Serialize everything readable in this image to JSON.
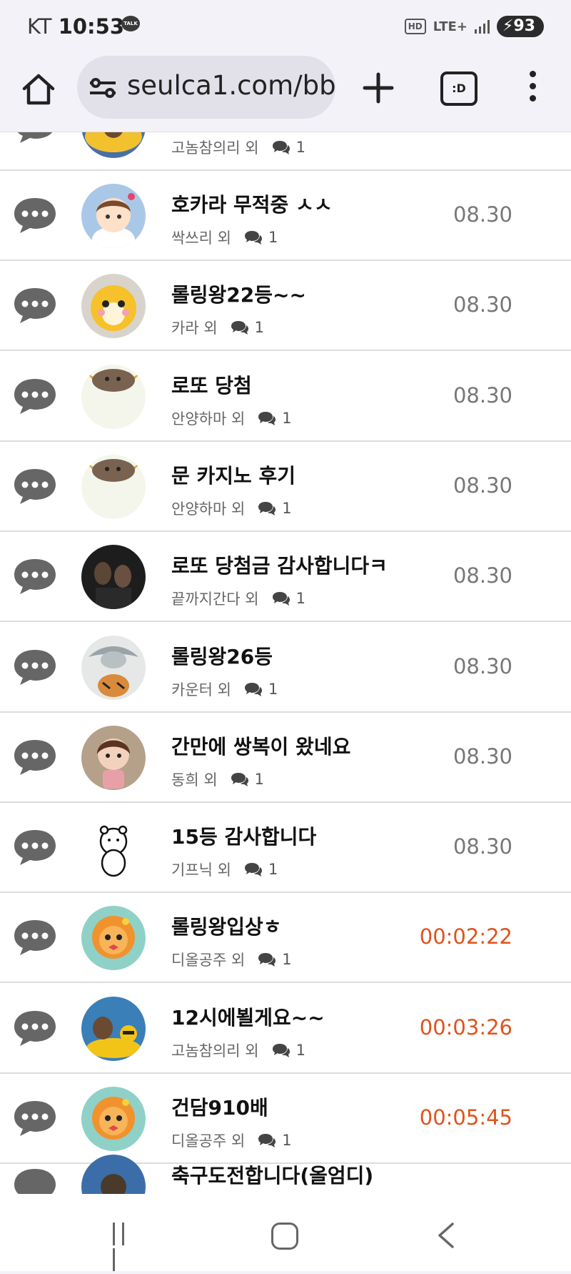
{
  "status_bar": {
    "carrier": "KT",
    "time": "10:53",
    "talk_badge": "TALK",
    "hd_label": "HD",
    "network": "LTE+",
    "battery": "93"
  },
  "browser": {
    "url": "seulca1.com/bb",
    "tabs_label": ":D"
  },
  "list": {
    "partial_top": {
      "author": "고놈참의리 외",
      "comments": "1"
    },
    "rows": [
      {
        "title": "호카라 무적중 ㅅㅅ",
        "author": "싹쓰리 외",
        "comments": "1",
        "date": "08.30",
        "recent": false,
        "avatar": "girl"
      },
      {
        "title": "롤링왕22등~~",
        "author": "카라 외",
        "comments": "1",
        "date": "08.30",
        "recent": false,
        "avatar": "tiger-cub"
      },
      {
        "title": "로또 당첨",
        "author": "안양하마 외",
        "comments": "1",
        "date": "08.30",
        "recent": false,
        "avatar": "bowl-cat"
      },
      {
        "title": "문 카지노 후기",
        "author": "안양하마 외",
        "comments": "1",
        "date": "08.30",
        "recent": false,
        "avatar": "bowl-cat"
      },
      {
        "title": "로또 당첨금 감사합니다ㅋ",
        "author": "끝까지간다 외",
        "comments": "1",
        "date": "08.30",
        "recent": false,
        "avatar": "dark-photo"
      },
      {
        "title": "롤링왕26등",
        "author": "카운터 외",
        "comments": "1",
        "date": "08.30",
        "recent": false,
        "avatar": "dragon-tiger"
      },
      {
        "title": "간만에 쌍복이 왔네요",
        "author": "동희 외",
        "comments": "1",
        "date": "08.30",
        "recent": false,
        "avatar": "doll"
      },
      {
        "title": "15등 감사합니다",
        "author": "기프닉 외",
        "comments": "1",
        "date": "08.30",
        "recent": false,
        "avatar": "sketch-bear"
      },
      {
        "title": "롤링왕입상ㅎ",
        "author": "디올공주 외",
        "comments": "1",
        "date": "00:02:22",
        "recent": true,
        "avatar": "lion"
      },
      {
        "title": "12시에뵐게요~~",
        "author": "고놈참의리 외",
        "comments": "1",
        "date": "00:03:26",
        "recent": true,
        "avatar": "otter-duck"
      },
      {
        "title": "건담910배",
        "author": "디올공주 외",
        "comments": "1",
        "date": "00:05:45",
        "recent": true,
        "avatar": "lion"
      }
    ],
    "partial_bottom_title": "축구도전합니다(올엄디)"
  },
  "colors": {
    "recent_date": "#e0531c",
    "normal_date": "#777777",
    "icon_gray": "#666666"
  }
}
